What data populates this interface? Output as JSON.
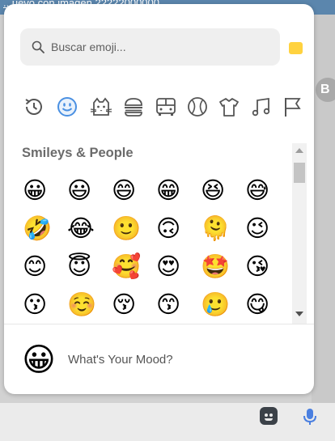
{
  "background": {
    "header_text": "...uevo con imagen 22222000000",
    "avatar_letter": "B"
  },
  "search": {
    "placeholder": "Buscar emoji..."
  },
  "colors": {
    "skin_tone": "#ffd23f",
    "active_category": "#4a90e2",
    "category_icon": "#555555"
  },
  "categories": [
    {
      "name": "recent",
      "icon": "clock-icon"
    },
    {
      "name": "smileys",
      "icon": "smiley-icon",
      "active": true
    },
    {
      "name": "animals",
      "icon": "cat-icon"
    },
    {
      "name": "food",
      "icon": "burger-icon"
    },
    {
      "name": "travel",
      "icon": "bus-icon"
    },
    {
      "name": "activities",
      "icon": "ball-icon"
    },
    {
      "name": "objects",
      "icon": "tshirt-icon"
    },
    {
      "name": "symbols",
      "icon": "music-note-icon"
    },
    {
      "name": "flags",
      "icon": "flag-icon"
    }
  ],
  "section": {
    "title": "Smileys & People"
  },
  "emoji_rows": [
    [
      "😀",
      "😃",
      "😄",
      "😁",
      "😆",
      "😅"
    ],
    [
      "🤣",
      "😂",
      "🙂",
      "🙃",
      "🫠",
      "😉"
    ],
    [
      "😊",
      "😇",
      "🥰",
      "😍",
      "🤩",
      "😘"
    ],
    [
      "😗",
      "☺️",
      "😚",
      "😙",
      "🥲",
      "😋"
    ]
  ],
  "footer": {
    "emoji": "😀",
    "label": "What's Your Mood?"
  }
}
